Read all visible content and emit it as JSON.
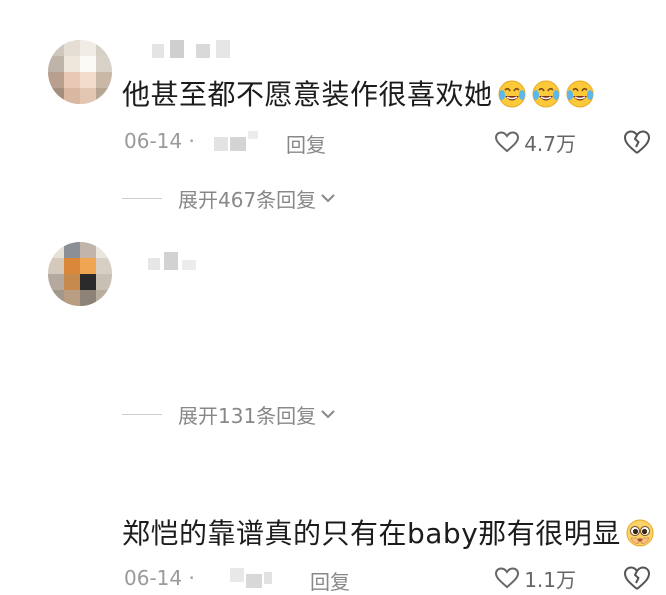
{
  "comments": [
    {
      "text": "他甚至都不愿意装作很喜欢她",
      "emojis": [
        "laughing-crying-emoji",
        "laughing-crying-emoji",
        "laughing-crying-emoji"
      ],
      "date": "06-14 ·",
      "reply_label": "回复",
      "likes": "4.7万",
      "expand_label": "展开467条回复"
    },
    {
      "text": "郑恺的靠谱真的只有在baby那有很明显",
      "emojis": [
        "pleading-emoji"
      ],
      "date": "06-14 ·",
      "reply_label": "回复",
      "likes": "1.1万",
      "expand_label": "展开131条回复"
    }
  ],
  "icons": {
    "like": "heart-outline-icon",
    "dislike": "broken-heart-icon",
    "expand": "chevron-down-icon"
  },
  "colors": {
    "text": "#1c1c1c",
    "meta": "#9a9a9a",
    "blur": "#cfcfcf"
  }
}
